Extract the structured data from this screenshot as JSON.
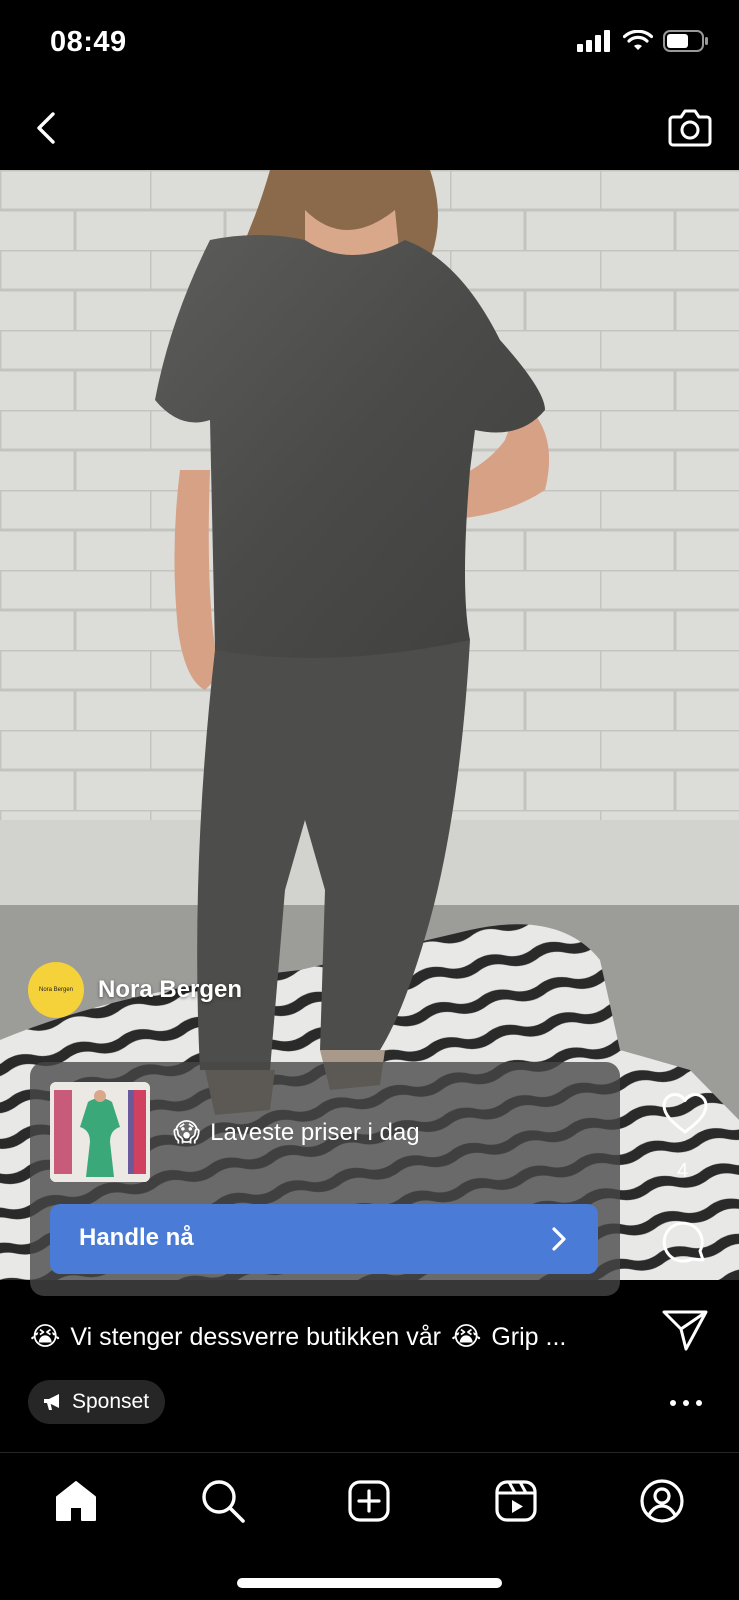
{
  "status_bar": {
    "time": "08:49"
  },
  "nav": {
    "back_icon": "chevron-left-icon",
    "camera_icon": "camera-icon"
  },
  "post": {
    "account_name": "Nora Bergen",
    "avatar_text": "Nora Bergen",
    "ad": {
      "emoji": "😱",
      "headline": "Laveste priser i dag",
      "cta_label": "Handle nå"
    },
    "like_count": "4",
    "caption_emoji_start": "😭",
    "caption_text": "Vi stenger dessverre butikken vår",
    "caption_emoji_end": "😭",
    "caption_more": "Grip ...",
    "sponsored_label": "Sponset"
  },
  "colors": {
    "cta_blue": "#4a7bd6",
    "avatar_yellow": "#f6d23a",
    "background": "#000000"
  },
  "tab_bar": {
    "items": [
      "home-icon",
      "search-icon",
      "create-icon",
      "reels-icon",
      "profile-icon"
    ]
  }
}
